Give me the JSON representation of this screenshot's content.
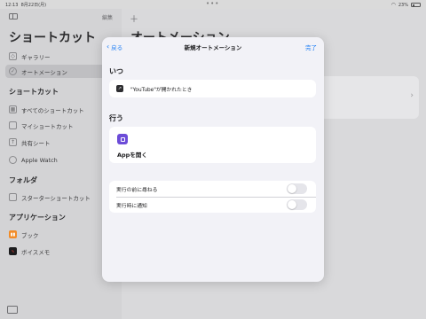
{
  "status_bar": {
    "time": "12:13",
    "date": "8月22日(月)",
    "dots": "•••",
    "battery": "23%"
  },
  "sidebar": {
    "edit_label": "編集",
    "title": "ショートカット",
    "top_items": [
      {
        "label": "ギャラリー",
        "icon": "gallery-icon"
      },
      {
        "label": "オートメーション",
        "icon": "automation-icon"
      }
    ],
    "sections": [
      {
        "title": "ショートカット",
        "items": [
          {
            "label": "すべてのショートカット",
            "icon": "squares-icon"
          },
          {
            "label": "マイショートカット",
            "icon": "square-icon"
          },
          {
            "label": "共有シート",
            "icon": "share-icon"
          },
          {
            "label": "Apple Watch",
            "icon": "watch-icon"
          }
        ]
      },
      {
        "title": "フォルダ",
        "items": [
          {
            "label": "スターターショートカット",
            "icon": "folder-icon"
          }
        ]
      },
      {
        "title": "アプリケーション",
        "items": [
          {
            "label": "ブック",
            "icon": "books-app-icon",
            "color": "#f28c28"
          },
          {
            "label": "ボイスメモ",
            "icon": "voice-memos-app-icon",
            "color": "#1c1c1e"
          }
        ]
      }
    ]
  },
  "main": {
    "title": "オートメーション"
  },
  "sheet": {
    "back_label": "戻る",
    "title": "新規オートメーション",
    "done_label": "完了",
    "when_header": "いつ",
    "trigger_text": "\"YouTube\"が開かれたとき",
    "do_header": "行う",
    "action_label": "Appを開く",
    "accent_color": "#1a7cf5",
    "action_icon_color": "#6c4cd8",
    "options": [
      {
        "label": "実行の前に尋ねる",
        "on": false
      },
      {
        "label": "実行時に通知",
        "on": false
      }
    ]
  }
}
